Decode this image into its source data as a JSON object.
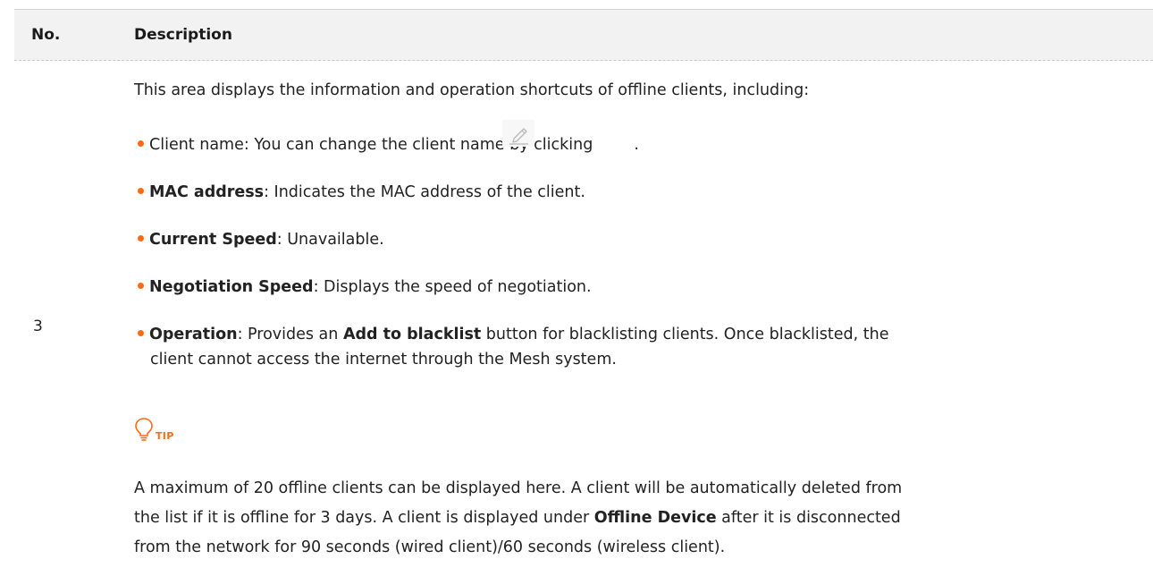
{
  "header": {
    "no_label": "No.",
    "description_label": "Description"
  },
  "row": {
    "number": "3",
    "intro": "This area displays the information and operation shortcuts of offline clients, including:",
    "bullets": [
      {
        "label": "",
        "text": "Client name: You can change the client name by clicking",
        "after_icon": "."
      },
      {
        "label": "MAC address",
        "text": ": Indicates the MAC address of the client."
      },
      {
        "label": "Current Speed",
        "text": ": Unavailable."
      },
      {
        "label": "Negotiation Speed",
        "text": ": Displays the speed of negotiation."
      },
      {
        "label": "Operation",
        "text_a": ": Provides an ",
        "label2": "Add to blacklist",
        "text_b": " button for blacklisting clients. Once blacklisted, the",
        "text_c": "client cannot access the internet through the Mesh system."
      }
    ],
    "edit_icon": "pencil-icon",
    "tip_label": "TIP",
    "tip_icon": "lightbulb-icon",
    "tip_lines": {
      "line1": "A maximum of 20 offline clients can be displayed here. A client will be automatically deleted from",
      "line2_a": "the list if it is offline for 3 days. A client is displayed under ",
      "line2_bold": "Offline Device",
      "line2_b": " after it is disconnected",
      "line3": "from the network for 90 seconds (wired client)/60 seconds (wireless client)."
    }
  },
  "colors": {
    "bullet": "#ff6a13",
    "tip": "#ff6a13",
    "header_bg": "#f2f2f2"
  }
}
